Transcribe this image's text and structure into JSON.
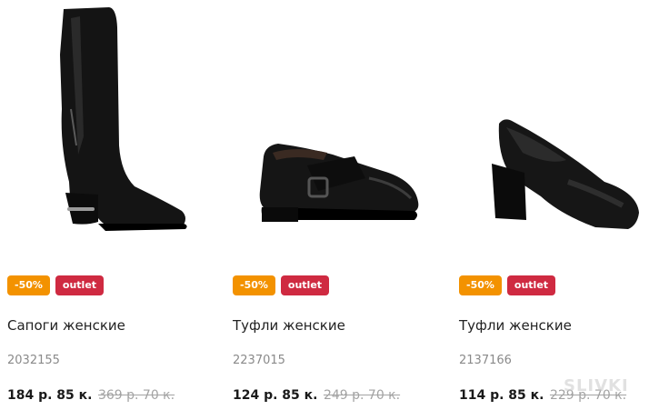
{
  "colors": {
    "discount_badge": "#f39200",
    "outlet_badge": "#cf2a41",
    "old_price": "#a3a3a3",
    "sku": "#8a8a8a"
  },
  "products": [
    {
      "image_icon": "knee-high-boot-image",
      "discount_badge": "-50%",
      "outlet_badge": "outlet",
      "name": "Сапоги женские",
      "sku": "2032155",
      "price_now": "184 р. 85 к.",
      "price_old": "369 р. 70 к."
    },
    {
      "image_icon": "buckle-shoe-image",
      "discount_badge": "-50%",
      "outlet_badge": "outlet",
      "name": "Туфли женские",
      "sku": "2237015",
      "price_now": "124 р. 85 к.",
      "price_old": "249 р. 70 к."
    },
    {
      "image_icon": "block-heel-pump-image",
      "discount_badge": "-50%",
      "outlet_badge": "outlet",
      "name": "Туфли женские",
      "sku": "2137166",
      "price_now": "114 р. 85 к.",
      "price_old": "229 р. 70 к."
    }
  ],
  "watermark": "SLIVKI"
}
